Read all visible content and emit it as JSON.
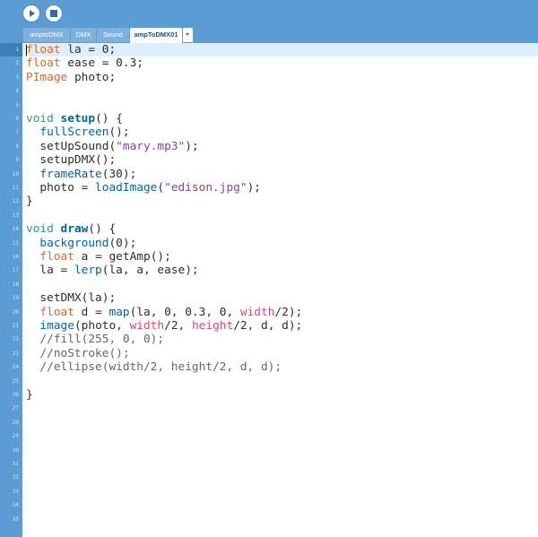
{
  "toolbar": {
    "run_icon": "play-icon",
    "stop_icon": "stop-icon"
  },
  "tabs": [
    "amptoDMX",
    "DMX",
    "Sound",
    "ampToDMX01"
  ],
  "active_tab": "ampToDMX01",
  "tab_menu_icon": "chevron-down-icon",
  "colors": {
    "toolbar_bg": "#5c9cd2",
    "gutter_bg": "#5c9cd2",
    "line_highlight": "#dcefff",
    "type_keyword": "#e2661a",
    "structure_keyword": "#33997e",
    "function": "#006699",
    "constant": "#d94a7a",
    "string": "#7d4793",
    "comment": "#666666",
    "default_text": "#2c2c2c"
  },
  "editor": {
    "line_numbers": [
      "1",
      "2",
      "3",
      "4",
      "5",
      "6",
      "7",
      "8",
      "9",
      "10",
      "11",
      "12",
      "13",
      "14",
      "15",
      "16",
      "17",
      "18",
      "19",
      "20",
      "21",
      "22",
      "23",
      "24",
      "25",
      "26",
      "27",
      "28",
      "29",
      "30",
      "31",
      "32",
      "33",
      "34",
      "35"
    ],
    "lines": [
      [
        {
          "t": "float",
          "k": "type"
        },
        {
          "t": " la = 0;"
        }
      ],
      [
        {
          "t": "float",
          "k": "type"
        },
        {
          "t": " ease = 0.3;"
        }
      ],
      [
        {
          "t": "PImage",
          "k": "type"
        },
        {
          "t": " photo;"
        }
      ],
      [],
      [],
      [
        {
          "t": "void",
          "k": "kw"
        },
        {
          "t": " "
        },
        {
          "t": "setup",
          "k": "fnbold"
        },
        {
          "t": "() {"
        }
      ],
      [
        {
          "t": "  "
        },
        {
          "t": "fullScreen",
          "k": "fn"
        },
        {
          "t": "();"
        }
      ],
      [
        {
          "t": "  setUpSound("
        },
        {
          "t": "\"mary.mp3\"",
          "k": "str"
        },
        {
          "t": ");"
        }
      ],
      [
        {
          "t": "  setupDMX();"
        }
      ],
      [
        {
          "t": "  "
        },
        {
          "t": "frameRate",
          "k": "fn"
        },
        {
          "t": "(30);"
        }
      ],
      [
        {
          "t": "  photo = "
        },
        {
          "t": "loadImage",
          "k": "fn"
        },
        {
          "t": "("
        },
        {
          "t": "\"edison.jpg\"",
          "k": "str"
        },
        {
          "t": ");"
        }
      ],
      [
        {
          "t": "}"
        }
      ],
      [],
      [
        {
          "t": "void",
          "k": "kw"
        },
        {
          "t": " "
        },
        {
          "t": "draw",
          "k": "fnbold"
        },
        {
          "t": "() {"
        }
      ],
      [
        {
          "t": "  "
        },
        {
          "t": "background",
          "k": "fn"
        },
        {
          "t": "(0);"
        }
      ],
      [
        {
          "t": "  "
        },
        {
          "t": "float",
          "k": "type"
        },
        {
          "t": " a = getAmp();"
        }
      ],
      [
        {
          "t": "  la = "
        },
        {
          "t": "lerp",
          "k": "fn"
        },
        {
          "t": "(la, a, ease);"
        }
      ],
      [],
      [
        {
          "t": "  setDMX(la);"
        }
      ],
      [
        {
          "t": "  "
        },
        {
          "t": "float",
          "k": "type"
        },
        {
          "t": " d = "
        },
        {
          "t": "map",
          "k": "fn"
        },
        {
          "t": "(la, 0, 0.3, 0, "
        },
        {
          "t": "width",
          "k": "const"
        },
        {
          "t": "/2);"
        }
      ],
      [
        {
          "t": "  "
        },
        {
          "t": "image",
          "k": "fn"
        },
        {
          "t": "(photo, "
        },
        {
          "t": "width",
          "k": "const"
        },
        {
          "t": "/2, "
        },
        {
          "t": "height",
          "k": "const"
        },
        {
          "t": "/2, d, d);"
        }
      ],
      [
        {
          "t": "  //fill(255, 0, 0);",
          "k": "comment"
        }
      ],
      [
        {
          "t": "  //noStroke();",
          "k": "comment"
        }
      ],
      [
        {
          "t": "  //ellipse(width/2, height/2, d, d);",
          "k": "comment"
        }
      ],
      [],
      [
        {
          "t": "}"
        }
      ]
    ]
  }
}
